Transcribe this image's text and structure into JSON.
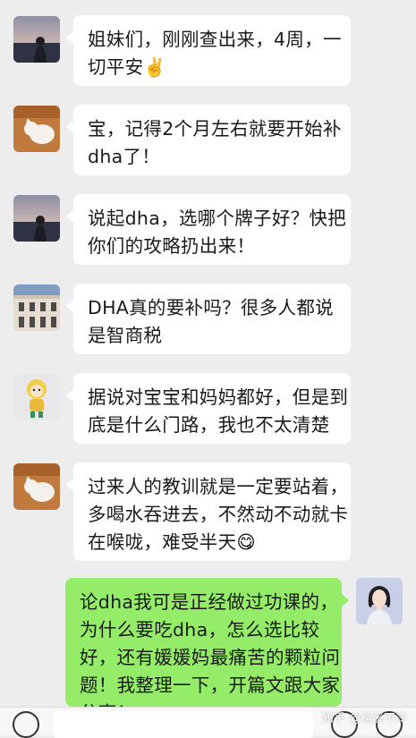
{
  "chat": {
    "messages": [
      {
        "sender": "other",
        "avatar": "avatar-girl-sunset",
        "lines": [
          "姐妹们，刚刚查出来，4周，一",
          "切平安✌️"
        ]
      },
      {
        "sender": "other",
        "avatar": "avatar-cat",
        "lines": [
          "宝，记得2个月左右就要开始补",
          "dha了！"
        ]
      },
      {
        "sender": "other",
        "avatar": "avatar-girl-sunset",
        "lines": [
          "说起dha，选哪个牌子好？快把",
          "你们的攻略扔出来！"
        ]
      },
      {
        "sender": "other",
        "avatar": "avatar-building",
        "lines": [
          "DHA真的要补吗？很多人都说",
          "是智商税"
        ]
      },
      {
        "sender": "other",
        "avatar": "avatar-doll",
        "lines": [
          "据说对宝宝和妈妈都好，但是到",
          "底是什么门路，我也不太清楚"
        ]
      },
      {
        "sender": "other",
        "avatar": "avatar-cat",
        "lines": [
          "过来人的教训就是一定要站着，",
          "多喝水吞进去，不然动不动就卡",
          "在喉咙，难受半天😋"
        ]
      },
      {
        "sender": "me",
        "avatar": "avatar-illustrated-woman",
        "lines": [
          "论dha我可是正经做过功课的，",
          "为什么要吃dha，怎么选比较",
          "好，还有媛媛妈最痛苦的颗粒问",
          "题！我整理一下，开篇文跟大家",
          "分享！"
        ]
      }
    ]
  },
  "watermark": "知乎 @稻溪不冷",
  "colors": {
    "background": "#ededed",
    "bubble_other": "#ffffff",
    "bubble_me": "#95ec69"
  }
}
